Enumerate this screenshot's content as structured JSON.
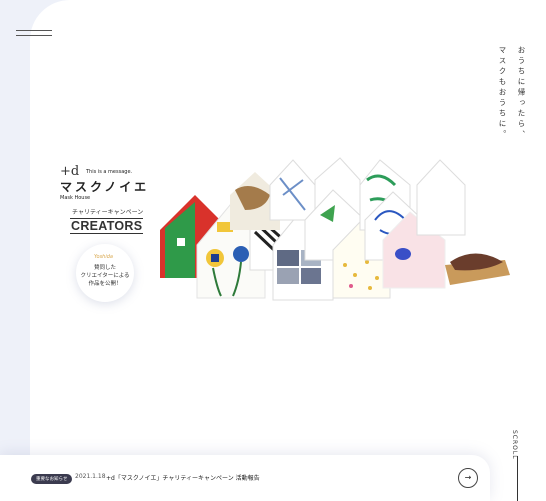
{
  "menu": {
    "icon": "hamburger-menu-icon"
  },
  "tagline_right": "おうちに帰ったら、",
  "tagline_left": "マスクもおうちに。",
  "logo": {
    "mark": "+d",
    "message": "This is a message.",
    "title": "マスクノイエ",
    "subtitle": "Mask House"
  },
  "campaign": "チャリティーキャンペーン",
  "creators": "CREATORS",
  "circle": {
    "signature": "Yoshida",
    "lines": [
      "賛同した",
      "クリエイターによる",
      "作品を公開！"
    ]
  },
  "news": {
    "badge": "重要なお知らせ",
    "date": "2021.1.18",
    "text": "+d「マスクノイエ」チャリティーキャンペーン 活動報告",
    "arrow": "→"
  },
  "scroll": "SCROLL"
}
